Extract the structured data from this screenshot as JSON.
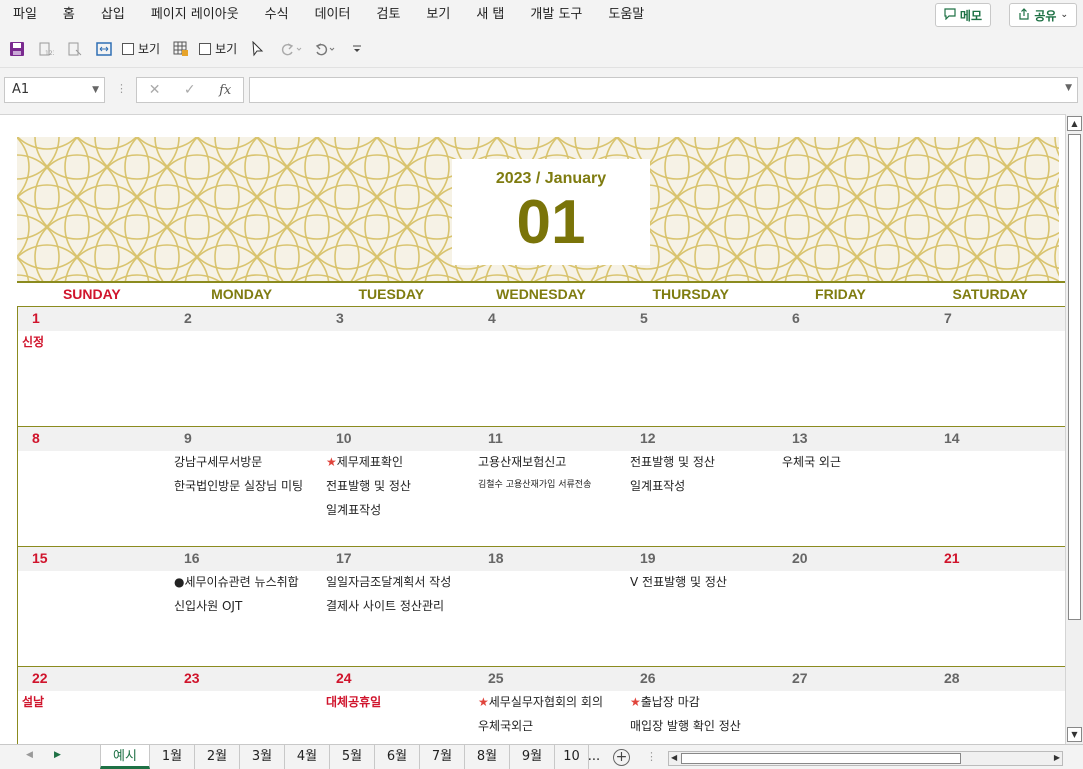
{
  "menu": [
    "파일",
    "홈",
    "삽입",
    "페이지 레이아웃",
    "수식",
    "데이터",
    "검토",
    "보기",
    "새 탭",
    "개발 도구",
    "도움말"
  ],
  "memo_label": "메모",
  "share_label": "공유",
  "qat": {
    "view1": "보기",
    "view2": "보기"
  },
  "namebox": "A1",
  "fx_label": "fx",
  "calendar": {
    "subtitle": "2023 / January",
    "month_number": "01",
    "day_names": [
      "SUNDAY",
      "MONDAY",
      "TUESDAY",
      "WEDNESDAY",
      "THURSDAY",
      "FRIDAY",
      "SATURDAY"
    ],
    "weeks": [
      {
        "days": [
          {
            "num": "1",
            "red": true,
            "events": [
              {
                "text": "신정",
                "style": "red"
              }
            ]
          },
          {
            "num": "2",
            "red": false,
            "events": []
          },
          {
            "num": "3",
            "red": false,
            "events": []
          },
          {
            "num": "4",
            "red": false,
            "events": []
          },
          {
            "num": "5",
            "red": false,
            "events": []
          },
          {
            "num": "6",
            "red": false,
            "events": []
          },
          {
            "num": "7",
            "red": false,
            "events": []
          }
        ]
      },
      {
        "days": [
          {
            "num": "8",
            "red": true,
            "events": []
          },
          {
            "num": "9",
            "red": false,
            "events": [
              {
                "text": "강남구세무서방문"
              },
              {
                "text": "한국법인방문 실장님 미팅"
              }
            ]
          },
          {
            "num": "10",
            "red": false,
            "events": [
              {
                "text": "제무제표확인",
                "star": "★"
              },
              {
                "text": "전표발행 및 정산"
              },
              {
                "text": "일계표작성"
              }
            ]
          },
          {
            "num": "11",
            "red": false,
            "events": [
              {
                "text": "고용산재보험신고"
              },
              {
                "text": "김철수 고용산재가입 서류전송",
                "style": "small"
              }
            ]
          },
          {
            "num": "12",
            "red": false,
            "events": [
              {
                "text": "전표발행 및 정산"
              },
              {
                "text": "일계표작성"
              }
            ]
          },
          {
            "num": "13",
            "red": false,
            "events": [
              {
                "text": "우체국 외근"
              }
            ]
          },
          {
            "num": "14",
            "red": false,
            "events": []
          }
        ]
      },
      {
        "days": [
          {
            "num": "15",
            "red": true,
            "events": []
          },
          {
            "num": "16",
            "red": false,
            "events": [
              {
                "text": "●세무이슈관련 뉴스취합"
              },
              {
                "text": "신입사원 OJT"
              }
            ]
          },
          {
            "num": "17",
            "red": false,
            "events": [
              {
                "text": "일일자금조달계획서 작성"
              },
              {
                "text": "결제사 사이트 정산관리"
              }
            ]
          },
          {
            "num": "18",
            "red": false,
            "events": []
          },
          {
            "num": "19",
            "red": false,
            "events": [
              {
                "text": "V 전표발행 및 정산"
              }
            ]
          },
          {
            "num": "20",
            "red": false,
            "events": []
          },
          {
            "num": "21",
            "red": true,
            "events": []
          }
        ]
      },
      {
        "days": [
          {
            "num": "22",
            "red": true,
            "events": [
              {
                "text": "설날",
                "style": "red"
              }
            ]
          },
          {
            "num": "23",
            "red": true,
            "events": []
          },
          {
            "num": "24",
            "red": true,
            "events": [
              {
                "text": "대체공휴일",
                "style": "red"
              }
            ]
          },
          {
            "num": "25",
            "red": false,
            "events": [
              {
                "text": "세무실무자협회의 회의",
                "star": "★"
              },
              {
                "text": "우체국외근"
              }
            ]
          },
          {
            "num": "26",
            "red": false,
            "events": [
              {
                "text": "출납장 마감",
                "star": "★"
              },
              {
                "text": "매입장 발행 확인 정산"
              }
            ]
          },
          {
            "num": "27",
            "red": false,
            "events": []
          },
          {
            "num": "28",
            "red": false,
            "events": []
          }
        ]
      }
    ]
  },
  "sheet_tabs": [
    "예시",
    "1월",
    "2월",
    "3월",
    "4월",
    "5월",
    "6월",
    "7월",
    "8월",
    "9월",
    "10"
  ],
  "tabs_more": "...",
  "add_sheet": "+",
  "colors": {
    "accent_olive": "#7f7c10",
    "holiday_red": "#d0142c",
    "excel_green": "#1e7145"
  }
}
